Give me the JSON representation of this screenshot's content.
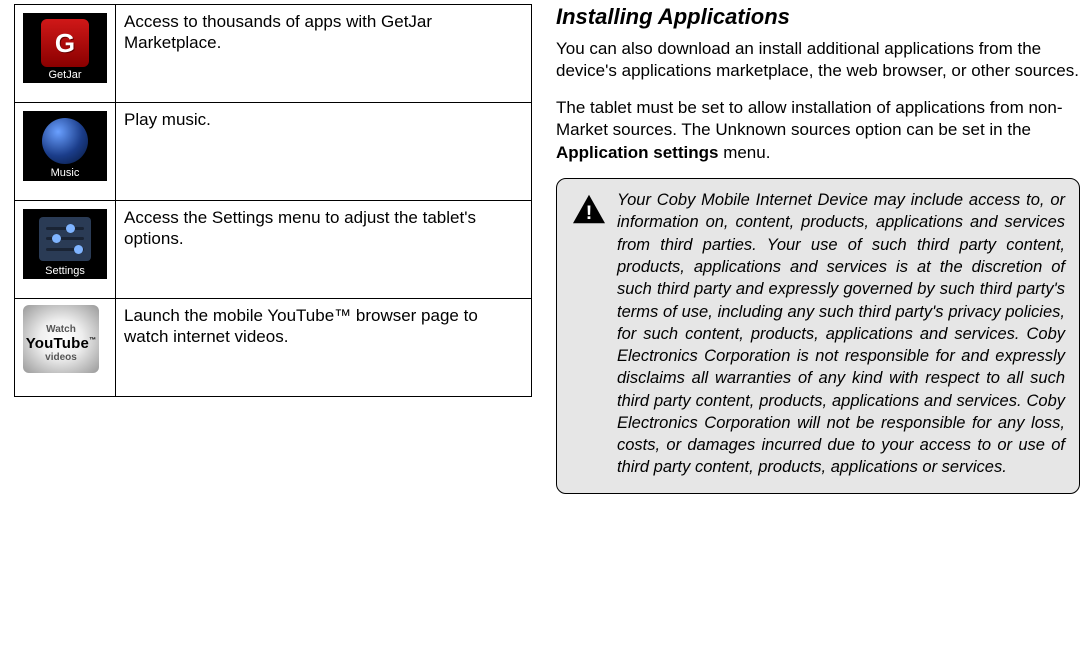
{
  "apps": [
    {
      "label": "GetJar",
      "desc": "Access to thousands of apps with GetJar Marketplace."
    },
    {
      "label": "Music",
      "desc": "Play music."
    },
    {
      "label": "Settings",
      "desc": "Access the Settings menu to adjust the tablet's options."
    },
    {
      "label": "",
      "desc": "Launch the mobile YouTube™ browser page to watch internet videos."
    }
  ],
  "youtube_icon": {
    "line1": "Watch",
    "line2": "YouTube",
    "line3": "videos"
  },
  "right": {
    "heading": "Installing Applications",
    "p1": "You can also download an install additional applications from the device's applications marketplace, the web browser, or other sources.",
    "p2_pre": "The tablet must be set to allow installation of applications from non-Market sources. The Unknown sources option can be set in the ",
    "p2_bold": "Application settings",
    "p2_post": " menu.",
    "notice": "Your Coby Mobile Internet Device may include access to, or information on, content, products, applications and services from third parties. Your use of such third party content, products, applications and services is at the discretion of such third party and expressly governed by such third party's terms of use, including any such third party's privacy policies, for such content, products, applications and services. Coby Electronics Corporation is not responsible for and expressly disclaims all warranties of any kind with respect to all such third party content, products, applications and services. Coby Electronics Corporation will not be responsible for any loss, costs, or damages incurred due to your access to or use of third party content, products, applications or services."
  }
}
